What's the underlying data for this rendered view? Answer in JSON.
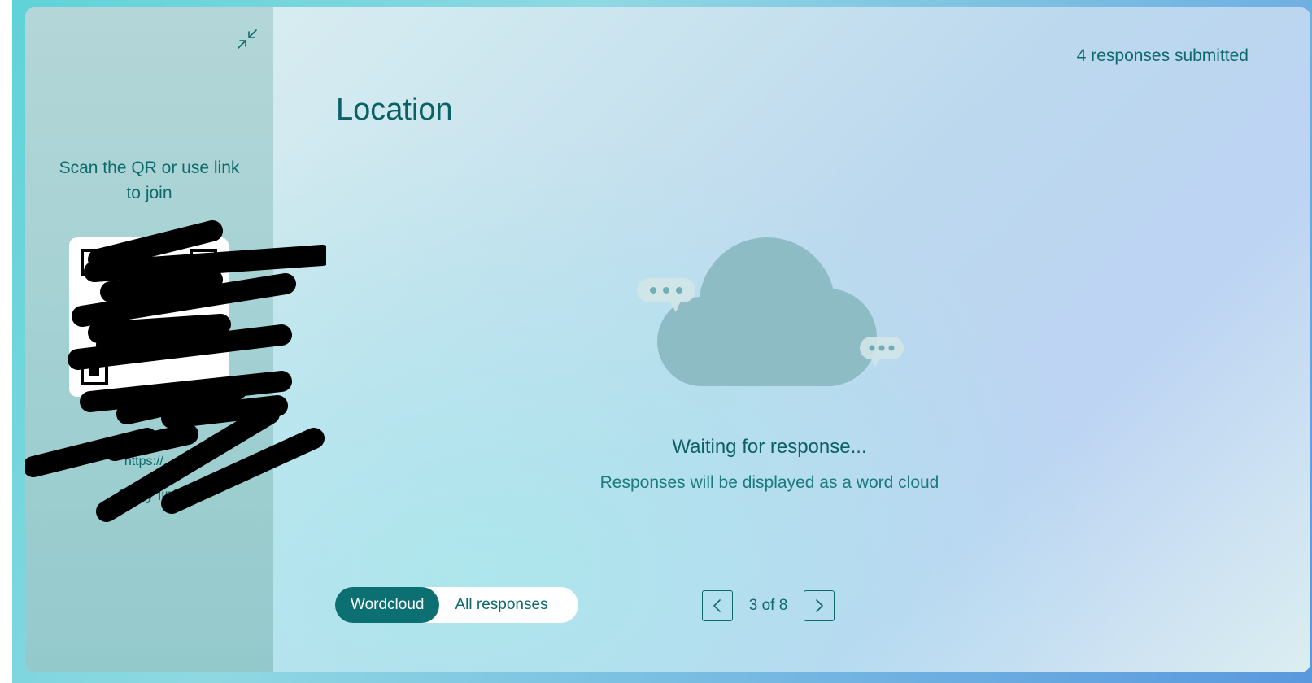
{
  "sidebar": {
    "collapse_icon": "collapse-arrows-icon",
    "join_text": "Scan the QR or use link to join",
    "join_link": "https://...",
    "copy_link_label": "Copy link"
  },
  "header": {
    "responses_submitted": "4 responses submitted",
    "title": "Location"
  },
  "empty_state": {
    "icon": "word-cloud-icon",
    "title": "Waiting for response...",
    "subtitle": "Responses will be displayed as a word cloud"
  },
  "view_toggle": {
    "options": [
      "Wordcloud",
      "All responses"
    ],
    "selected": "Wordcloud"
  },
  "pager": {
    "text": "3 of 8",
    "prev_icon": "chevron-left-icon",
    "next_icon": "chevron-right-icon"
  },
  "colors": {
    "accent": "#0c6f71",
    "text": "#0c6a6c",
    "cloud": "#8dbcc5"
  }
}
